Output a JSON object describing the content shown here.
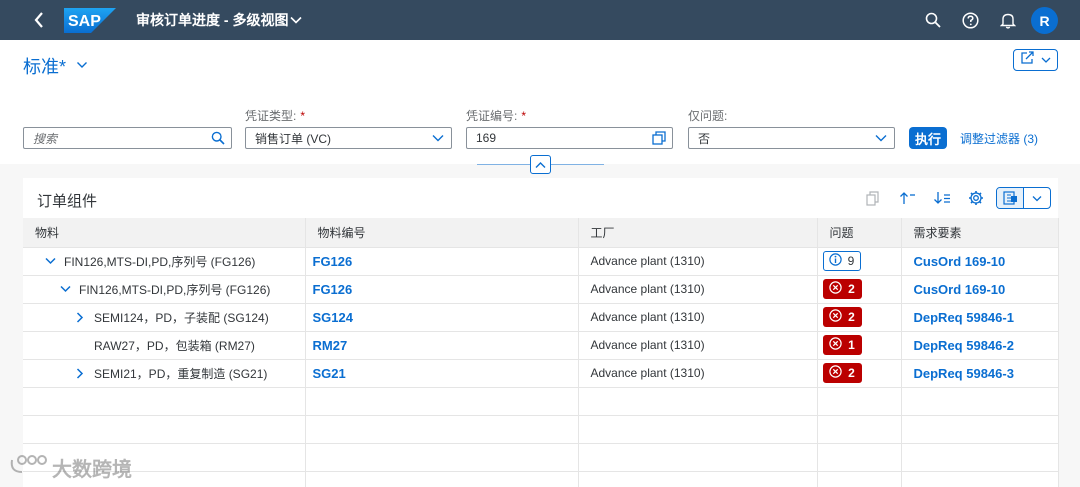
{
  "shell": {
    "logo_text": "SAP",
    "title": "审核订单进度 - 多级视图",
    "avatar_initial": "R"
  },
  "header": {
    "variant_name": "标准*",
    "filters": {
      "search_placeholder": "搜索",
      "voucher_type_label": "凭证类型:",
      "voucher_type_value": "销售订单 (VC)",
      "voucher_number_label": "凭证编号:",
      "voucher_number_value": "169",
      "issues_only_label": "仅问题:",
      "issues_only_value": "否",
      "required_mark": "*"
    },
    "execute_label": "执行",
    "adapt_filters_label": "调整过滤器 (3)"
  },
  "table": {
    "title": "订单组件",
    "columns": [
      "物料",
      "物料编号",
      "工厂",
      "问题",
      "需求要素"
    ],
    "rows": [
      {
        "material": "FIN126,MTS-DI,PD,序列号 (FG126)",
        "level": 1,
        "expander": "expanded",
        "material_number": "FG126",
        "plant": "Advance plant (1310)",
        "issue_type": "info",
        "issue_count": "9",
        "requirement": "CusOrd 169-10"
      },
      {
        "material": "FIN126,MTS-DI,PD,序列号 (FG126)",
        "level": 2,
        "expander": "expanded",
        "material_number": "FG126",
        "plant": "Advance plant (1310)",
        "issue_type": "error",
        "issue_count": "2",
        "requirement": "CusOrd 169-10"
      },
      {
        "material": "SEMI124，PD，子装配 (SG124)",
        "level": 3,
        "expander": "collapsed",
        "material_number": "SG124",
        "plant": "Advance plant (1310)",
        "issue_type": "error",
        "issue_count": "2",
        "requirement": "DepReq 59846-1"
      },
      {
        "material": "RAW27，PD，包装箱 (RM27)",
        "level": 3,
        "expander": "none",
        "material_number": "RM27",
        "plant": "Advance plant (1310)",
        "issue_type": "error",
        "issue_count": "1",
        "requirement": "DepReq 59846-2"
      },
      {
        "material": "SEMI21，PD，重复制造 (SG21)",
        "level": 3,
        "expander": "collapsed",
        "material_number": "SG21",
        "plant": "Advance plant (1310)",
        "issue_type": "error",
        "issue_count": "2",
        "requirement": "DepReq 59846-3"
      }
    ],
    "empty_rows": 4
  },
  "watermark": "大数跨境",
  "colors": {
    "shell_bg": "#354a5f",
    "accent": "#0a6ed1",
    "error": "#bb0000"
  }
}
